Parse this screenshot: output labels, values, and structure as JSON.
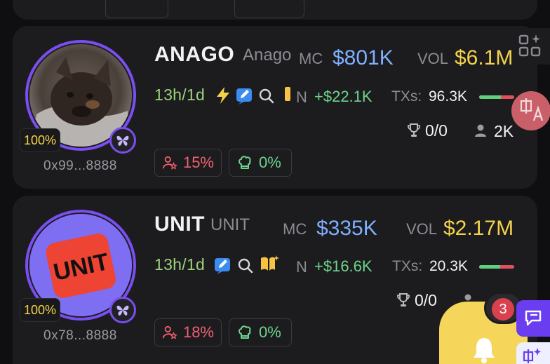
{
  "tokens": [
    {
      "name": "ANAGO",
      "symbol": "Anago",
      "mc_label": "MC",
      "mc_value": "$801K",
      "vol_label": "VOL",
      "vol_value": "$6.1M",
      "age": "13h/1d",
      "n_label": "N",
      "gain": "+$22.1K",
      "txs_label": "TXs:",
      "txs_value": "96.3K",
      "buy_ratio": 0.62,
      "trophy": "0/0",
      "holders": "2K",
      "pct_badge": "100%",
      "address": "0x99...8888",
      "dev_pct": "15%",
      "top_pct": "0%"
    },
    {
      "name": "UNIT",
      "symbol": "UNIT",
      "mc_label": "MC",
      "mc_value": "$335K",
      "vol_label": "VOL",
      "vol_value": "$2.17M",
      "age": "13h/1d",
      "n_label": "N",
      "gain": "+$16.6K",
      "txs_label": "TXs:",
      "txs_value": "20.3K",
      "buy_ratio": 0.6,
      "trophy": "0/0",
      "holders": "",
      "pct_badge": "100%",
      "address": "0x78...8888",
      "dev_pct": "18%",
      "top_pct": "0%",
      "logo_text": "UNIT"
    }
  ],
  "notification": {
    "count": "3"
  },
  "colors": {
    "accent": "#7a4ef0",
    "mc": "#7fb0ff",
    "vol": "#f4d34a",
    "gain": "#6ed48b",
    "danger": "#f06070",
    "bell": "#f6d65a"
  }
}
